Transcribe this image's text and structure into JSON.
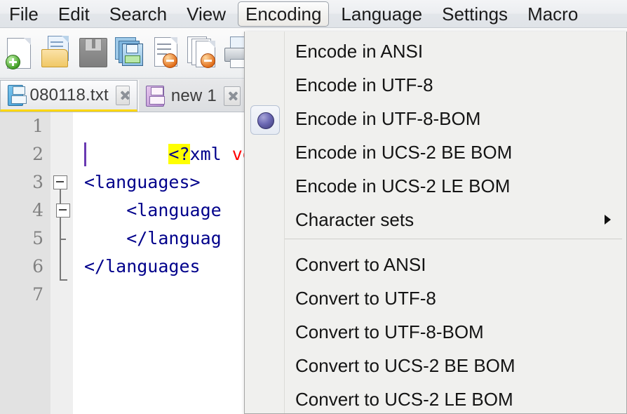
{
  "menubar": {
    "items": [
      {
        "label": "File",
        "state": "normal"
      },
      {
        "label": "Edit",
        "state": "normal"
      },
      {
        "label": "Search",
        "state": "normal"
      },
      {
        "label": "View",
        "state": "normal"
      },
      {
        "label": "Encoding",
        "state": "open"
      },
      {
        "label": "Language",
        "state": "normal"
      },
      {
        "label": "Settings",
        "state": "normal"
      },
      {
        "label": "Macro",
        "state": "normal"
      }
    ]
  },
  "toolbar": {
    "buttons": [
      {
        "name": "new-file",
        "icon": "new-document-icon"
      },
      {
        "name": "open-file",
        "icon": "open-folder-icon"
      },
      {
        "name": "save-file",
        "icon": "floppy-disk-icon"
      },
      {
        "name": "save-all",
        "icon": "save-all-icon"
      },
      {
        "name": "close-file",
        "icon": "close-document-icon"
      },
      {
        "name": "close-all",
        "icon": "close-all-documents-icon"
      },
      {
        "name": "print",
        "icon": "printer-icon"
      }
    ]
  },
  "tabs": [
    {
      "label": "080118.txt",
      "icon": "floppy-blue-icon",
      "active": true,
      "close": "x"
    },
    {
      "label": "new 1",
      "icon": "floppy-pink-icon",
      "active": false,
      "close": "x"
    }
  ],
  "editor": {
    "line_numbers": [
      "1",
      "2",
      "3",
      "4",
      "5",
      "6",
      "7"
    ],
    "current_line": 2,
    "lines": [
      {
        "n": 1,
        "text": "<?xml versi",
        "prefix_highlight": "<?",
        "fold": "none"
      },
      {
        "n": 2,
        "text": "",
        "fold": "none"
      },
      {
        "n": 3,
        "text": "<languages>",
        "fold": "open"
      },
      {
        "n": 4,
        "text": "    <language",
        "fold": "open"
      },
      {
        "n": 5,
        "text": "    </languag",
        "fold": "child"
      },
      {
        "n": 6,
        "text": "</languages",
        "fold": "end"
      },
      {
        "n": 7,
        "text": "",
        "fold": "none"
      }
    ],
    "colors": {
      "tag": "#00008b",
      "attribute": "#ff0000",
      "match_highlight": "#ffff00",
      "current_line_bg": "#e6e6f5",
      "gutter_bg": "#e2e2e2",
      "line_number": "#808080"
    },
    "bracket_match_right": "?>"
  },
  "menu": {
    "title": "Encoding",
    "groups": [
      {
        "name": "encode",
        "items": [
          {
            "label": "Encode in ANSI",
            "checked": false,
            "submenu": false
          },
          {
            "label": "Encode in UTF-8",
            "checked": false,
            "submenu": false
          },
          {
            "label": "Encode in UTF-8-BOM",
            "checked": true,
            "submenu": false
          },
          {
            "label": "Encode in UCS-2 BE BOM",
            "checked": false,
            "submenu": false
          },
          {
            "label": "Encode in UCS-2 LE BOM",
            "checked": false,
            "submenu": false
          },
          {
            "label": "Character sets",
            "checked": false,
            "submenu": true
          }
        ]
      },
      {
        "name": "convert",
        "items": [
          {
            "label": "Convert to ANSI",
            "checked": false,
            "submenu": false
          },
          {
            "label": "Convert to UTF-8",
            "checked": false,
            "submenu": false
          },
          {
            "label": "Convert to UTF-8-BOM",
            "checked": false,
            "submenu": false
          },
          {
            "label": "Convert to UCS-2 BE BOM",
            "checked": false,
            "submenu": false
          },
          {
            "label": "Convert to UCS-2 LE BOM",
            "checked": false,
            "submenu": false
          }
        ]
      }
    ],
    "selected_item": "Encode in UTF-8-BOM",
    "colors": {
      "background": "#f0f0ee",
      "border": "#a6a6a6",
      "separator": "#cfcfcb",
      "radio_dot": "#4a4890"
    }
  }
}
